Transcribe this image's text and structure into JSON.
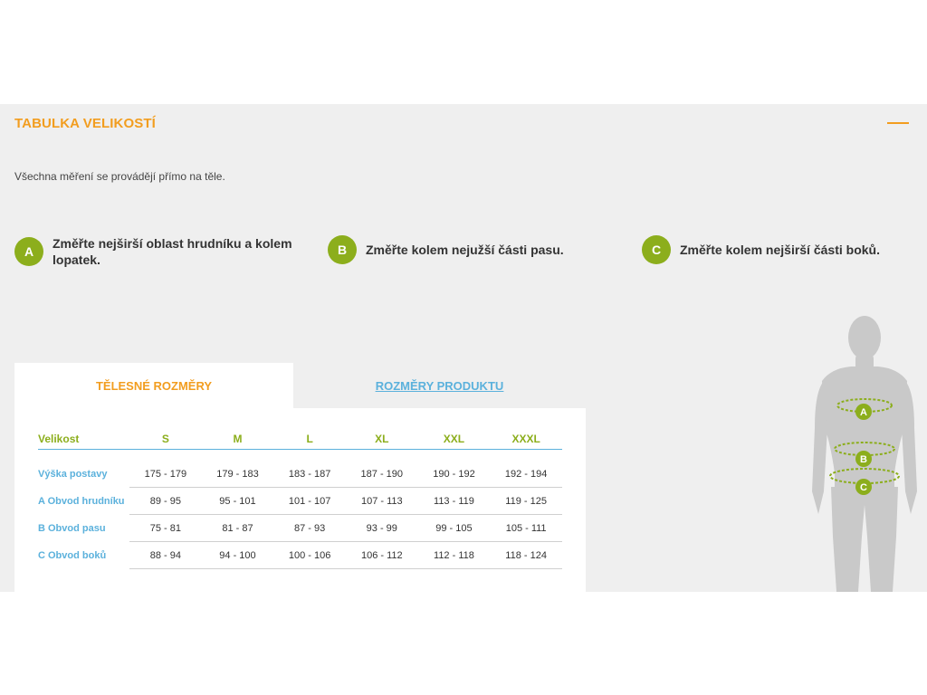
{
  "section": {
    "title": "TABULKA VELIKOSTÍ",
    "note": "Všechna měření se provádějí přímo na těle."
  },
  "steps": [
    {
      "badge": "A",
      "text": "Změřte nejširší oblast hrudníku a kolem lopatek."
    },
    {
      "badge": "B",
      "text": "Změřte kolem nejužší části pasu."
    },
    {
      "badge": "C",
      "text": "Změřte kolem nejširší části boků."
    }
  ],
  "tabs": {
    "active": "TĚLESNÉ ROZMĚRY",
    "inactive": "ROZMĚRY PRODUKTU"
  },
  "table": {
    "headers": [
      "Velikost",
      "S",
      "M",
      "L",
      "XL",
      "XXL",
      "XXXL"
    ],
    "rows": [
      {
        "label": "Výška postavy",
        "cells": [
          "175 - 179",
          "179 - 183",
          "183 - 187",
          "187 - 190",
          "190 - 192",
          "192 - 194"
        ]
      },
      {
        "label": "A Obvod hrudníku",
        "cells": [
          "89 - 95",
          "95 - 101",
          "101 - 107",
          "107 - 113",
          "113 - 119",
          "119 - 125"
        ]
      },
      {
        "label": "B Obvod pasu",
        "cells": [
          "75 - 81",
          "81 - 87",
          "87 - 93",
          "93 - 99",
          "99 - 105",
          "105 - 111"
        ]
      },
      {
        "label": "C Obvod boků",
        "cells": [
          "88 - 94",
          "94 - 100",
          "100 - 106",
          "106 - 112",
          "112 - 118",
          "118 - 124"
        ]
      }
    ]
  },
  "figure": {
    "markers": [
      "A",
      "B",
      "C"
    ]
  },
  "colors": {
    "accent_orange": "#f29d1f",
    "accent_green": "#8cae1c",
    "link_blue": "#5bb1dc",
    "section_bg": "#efefef",
    "silhouette": "#c9c9c9"
  }
}
